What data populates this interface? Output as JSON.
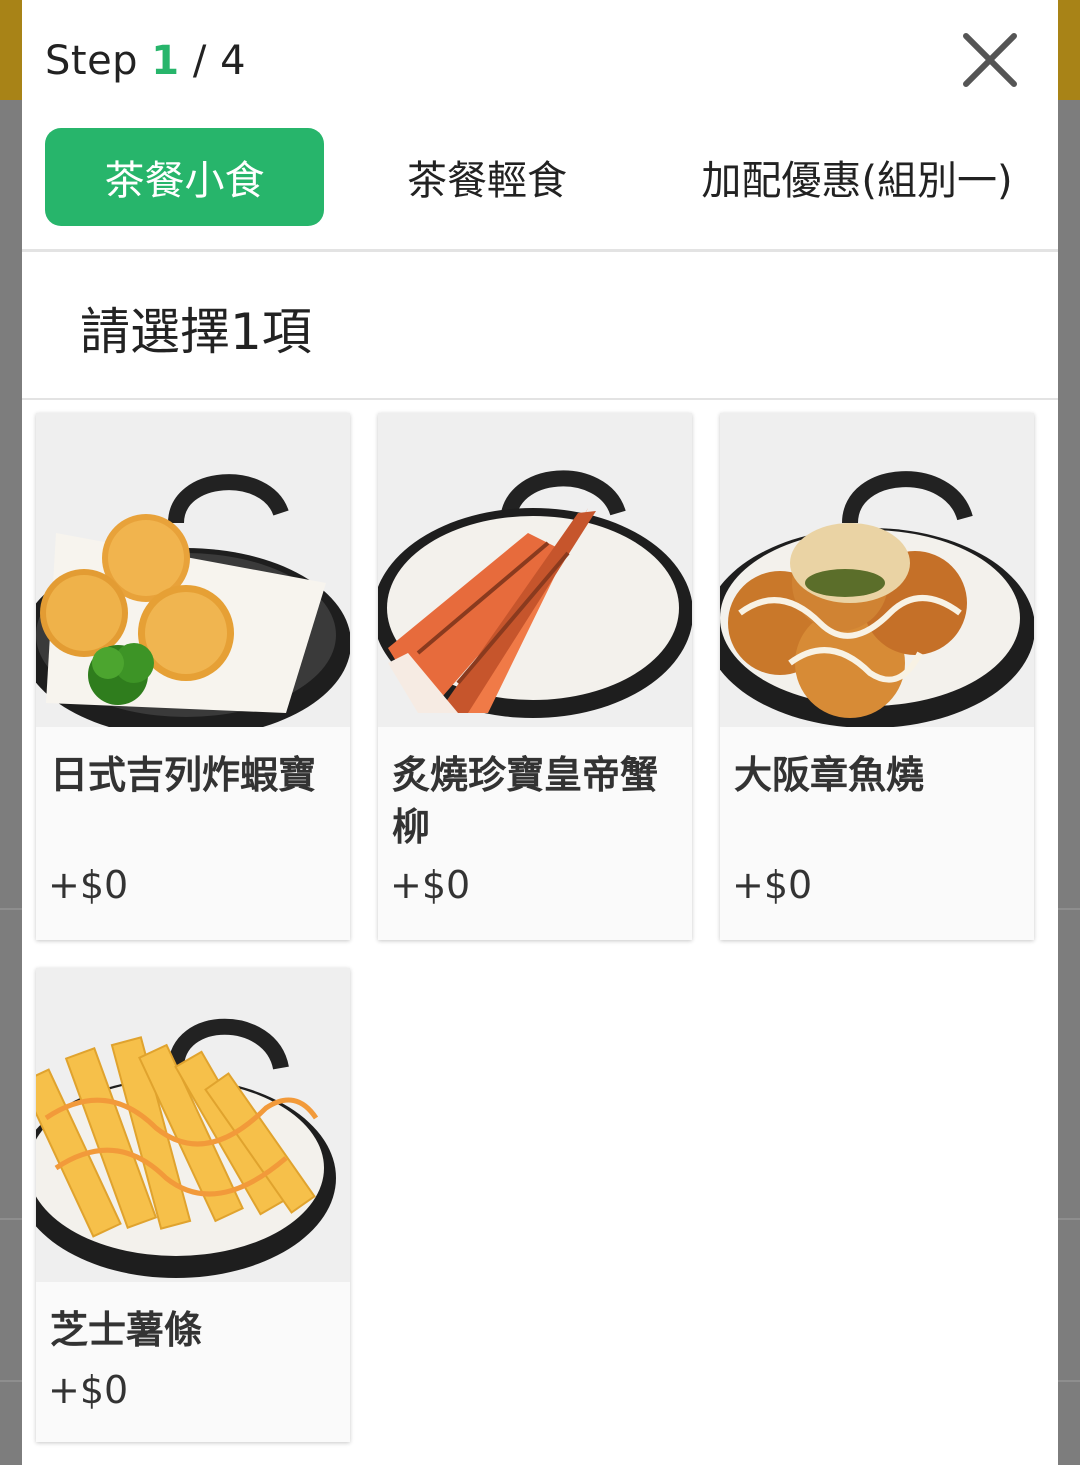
{
  "header": {
    "step_prefix": "Step",
    "step_current": "1",
    "step_separator": "/",
    "step_total": "4",
    "close_icon": "close-icon"
  },
  "tabs": [
    {
      "label": "茶餐小食",
      "active": true
    },
    {
      "label": "茶餐輕食",
      "active": false
    },
    {
      "label": "加配優惠(組別一)",
      "active": false
    }
  ],
  "instruction": "請選擇1項",
  "items": [
    {
      "name": "日式吉列炸蝦寶",
      "price": "+$0",
      "image": "fried-shrimp-balls-photo"
    },
    {
      "name": "炙燒珍寶皇帝蟹柳",
      "price": "+$0",
      "image": "grilled-crab-stick-photo"
    },
    {
      "name": "大阪章魚燒",
      "price": "+$0",
      "image": "takoyaki-photo"
    },
    {
      "name": "芝士薯條",
      "price": "+$0",
      "image": "cheese-fries-photo"
    }
  ],
  "colors": {
    "accent": "#27b56b",
    "backdrop_bar": "#a88317",
    "overlay": "#7d7d7d"
  }
}
